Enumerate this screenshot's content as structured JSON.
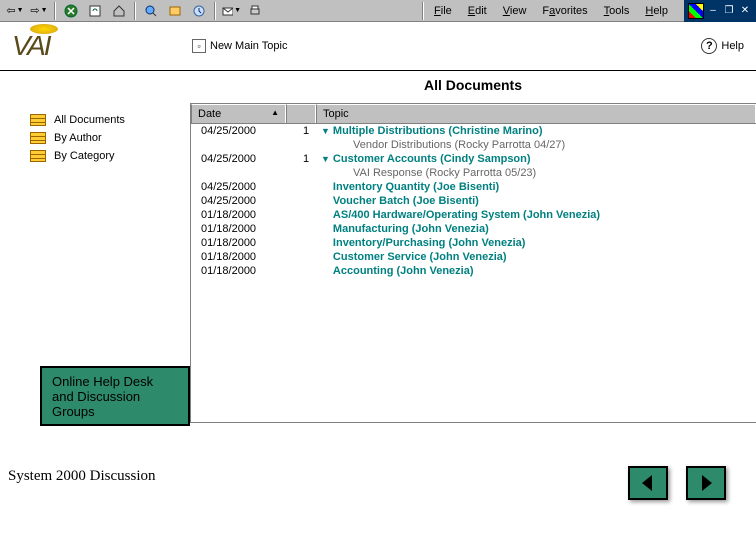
{
  "menubar": [
    "File",
    "Edit",
    "View",
    "Favorites",
    "Tools",
    "Help"
  ],
  "subbar": {
    "new_topic": "New Main Topic",
    "help": "Help"
  },
  "main_title": "All Documents",
  "sidebar": {
    "items": [
      {
        "label": "All Documents"
      },
      {
        "label": "By Author"
      },
      {
        "label": "By Category"
      }
    ]
  },
  "columns": {
    "date": "Date",
    "topic": "Topic"
  },
  "rows": [
    {
      "date": "04/25/2000",
      "count": "1",
      "twisty": true,
      "topic": "Multiple Distributions (Christine Marino)"
    },
    {
      "child": true,
      "topic": "Vendor Distributions  (Rocky Parrotta 04/27)"
    },
    {
      "date": "04/25/2000",
      "count": "1",
      "twisty": true,
      "topic": "Customer Accounts (Cindy Sampson)"
    },
    {
      "child": true,
      "topic": "VAI Response  (Rocky Parrotta 05/23)"
    },
    {
      "date": "04/25/2000",
      "topic": "Inventory Quantity (Joe Bisenti)"
    },
    {
      "date": "04/25/2000",
      "topic": "Voucher Batch (Joe Bisenti)"
    },
    {
      "date": "01/18/2000",
      "topic": "AS/400 Hardware/Operating System (John Venezia)"
    },
    {
      "date": "01/18/2000",
      "topic": "Manufacturing (John Venezia)"
    },
    {
      "date": "01/18/2000",
      "topic": "Inventory/Purchasing (John Venezia)"
    },
    {
      "date": "01/18/2000",
      "topic": "Customer Service (John Venezia)"
    },
    {
      "date": "01/18/2000",
      "topic": "Accounting (John Venezia)"
    }
  ],
  "green_box": "Online Help Desk and Discussion Groups",
  "footer": "System 2000 Discussion"
}
